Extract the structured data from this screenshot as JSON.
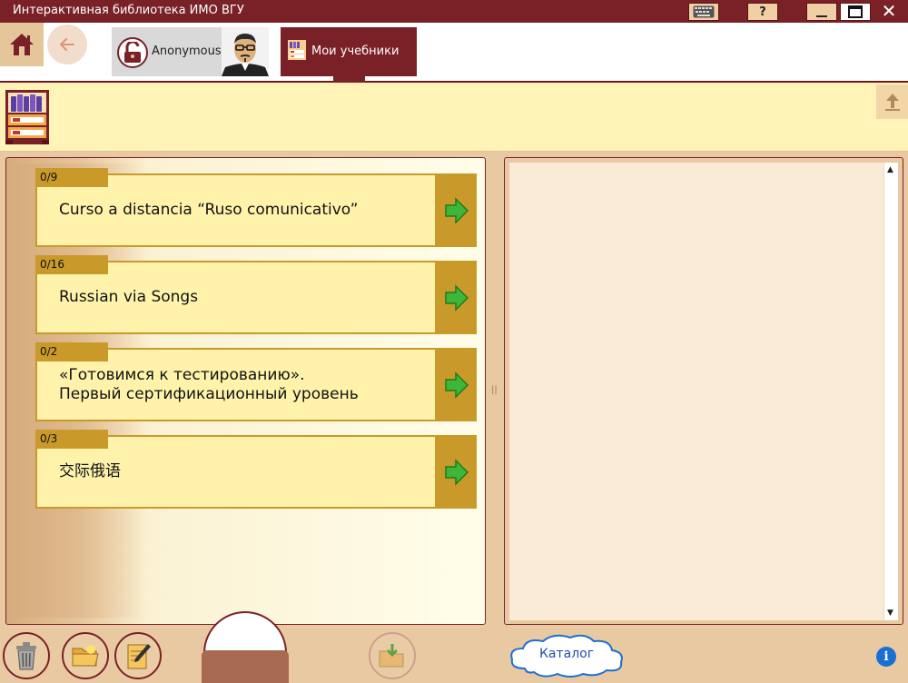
{
  "window": {
    "title": "Интерактивная библиотека ИМО ВГУ",
    "help_label": "?",
    "close_label": "✕"
  },
  "nav": {
    "user_name": "Anonymous",
    "tab_label": "Мои учебники"
  },
  "books": [
    {
      "progress": "0/9",
      "title": "Curso a distancia “Ruso comunicativo”"
    },
    {
      "progress": "0/16",
      "title": "Russian via Songs"
    },
    {
      "progress": "0/2",
      "title": "«Готовимся к тестированию».\nПервый сертификационный уровень"
    },
    {
      "progress": "0/3",
      "title": "交际俄语"
    }
  ],
  "scrollbar": {
    "up": "▲",
    "down": "▼"
  },
  "divider": "||",
  "bottom": {
    "catalog_label": "Каталог",
    "info_label": "i"
  },
  "colors": {
    "brand": "#7a2128",
    "card": "#fff3ac",
    "card_accent": "#c99a2a",
    "arrow": "#3fb63a"
  },
  "icons": {
    "home": "home-icon",
    "back": "back-arrow-icon",
    "lock": "unlocked-padlock-icon",
    "upload": "upload-arrow-icon",
    "trash": "trash-icon",
    "folder": "folder-icon",
    "edit": "edit-notebook-icon",
    "download": "download-folder-icon",
    "info": "info-icon"
  }
}
